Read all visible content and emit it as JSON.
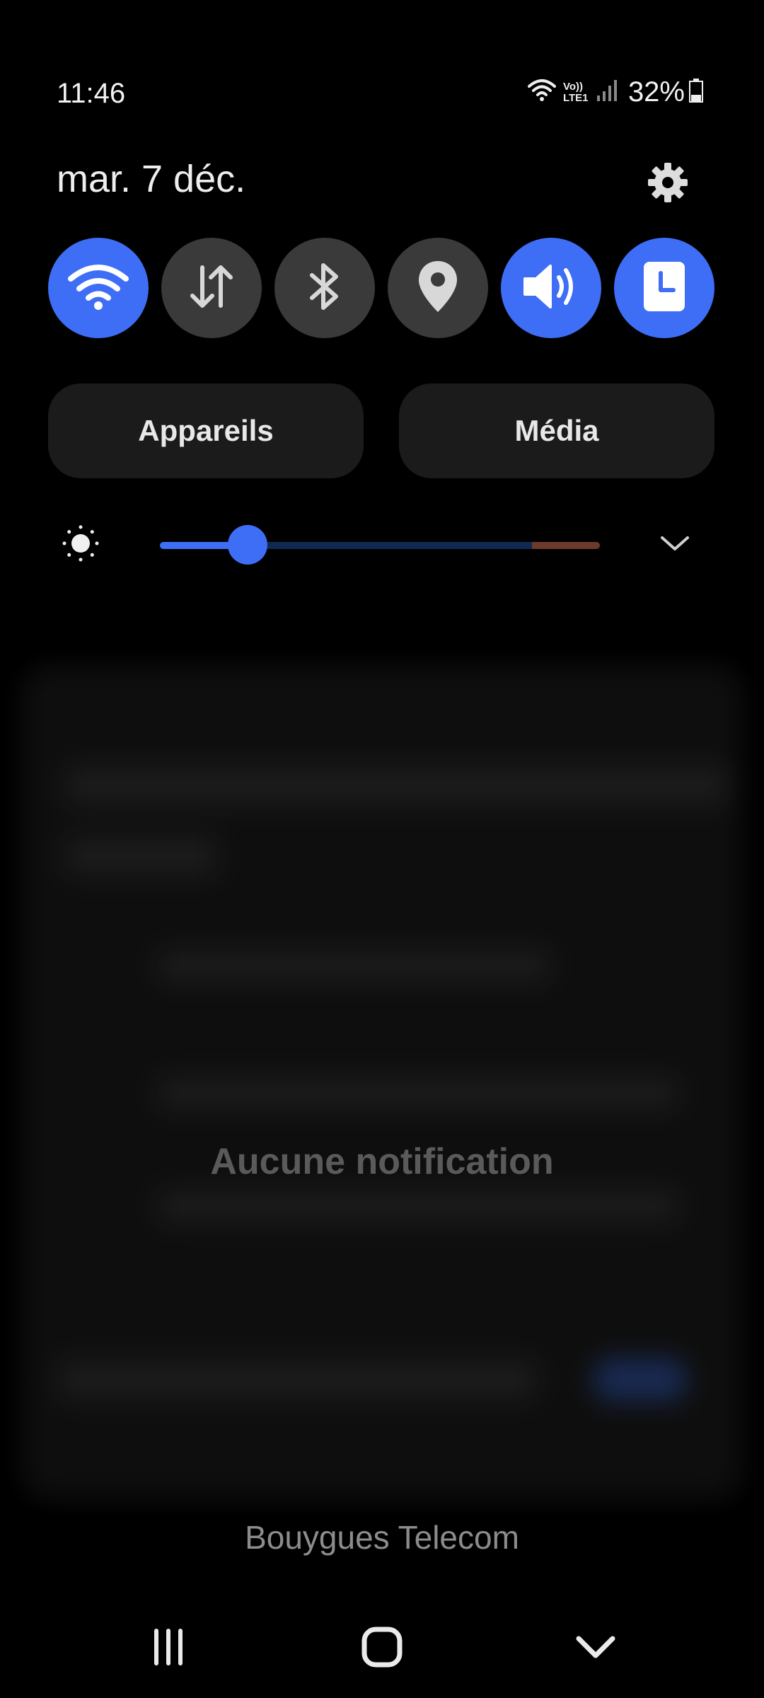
{
  "status_bar": {
    "time": "11:46",
    "volte_label": "Vo)) LTE1",
    "battery_percent": "32%",
    "battery_level": 0.32,
    "icons": [
      "wifi-icon",
      "volte-icon",
      "signal-icon",
      "battery-icon"
    ]
  },
  "header": {
    "date": "mar. 7 déc.",
    "settings_icon": "gear-icon"
  },
  "quick_toggles": [
    {
      "name": "wifi",
      "icon": "wifi-icon",
      "on": true
    },
    {
      "name": "mobile-data",
      "icon": "data-arrows-icon",
      "on": false
    },
    {
      "name": "bluetooth",
      "icon": "bluetooth-icon",
      "on": false
    },
    {
      "name": "location",
      "icon": "location-pin-icon",
      "on": false
    },
    {
      "name": "sound",
      "icon": "speaker-icon",
      "on": true
    },
    {
      "name": "screen-timeout",
      "icon": "clock-icon",
      "on": true
    }
  ],
  "panels": {
    "devices_label": "Appareils",
    "media_label": "Média"
  },
  "brightness": {
    "icon": "sun-icon",
    "level": 0.2,
    "expand_icon": "chevron-down-icon"
  },
  "notifications": {
    "empty_text": "Aucune notification"
  },
  "carrier": "Bouygues Telecom",
  "nav_bar": {
    "recents_icon": "recents-icon",
    "home_icon": "home-icon",
    "back_icon": "chevron-down-icon"
  },
  "colors": {
    "accent": "#3e6ef5",
    "toggle_off": "#3a3a3a",
    "pill_bg": "#1b1b1b",
    "background": "#000000"
  }
}
